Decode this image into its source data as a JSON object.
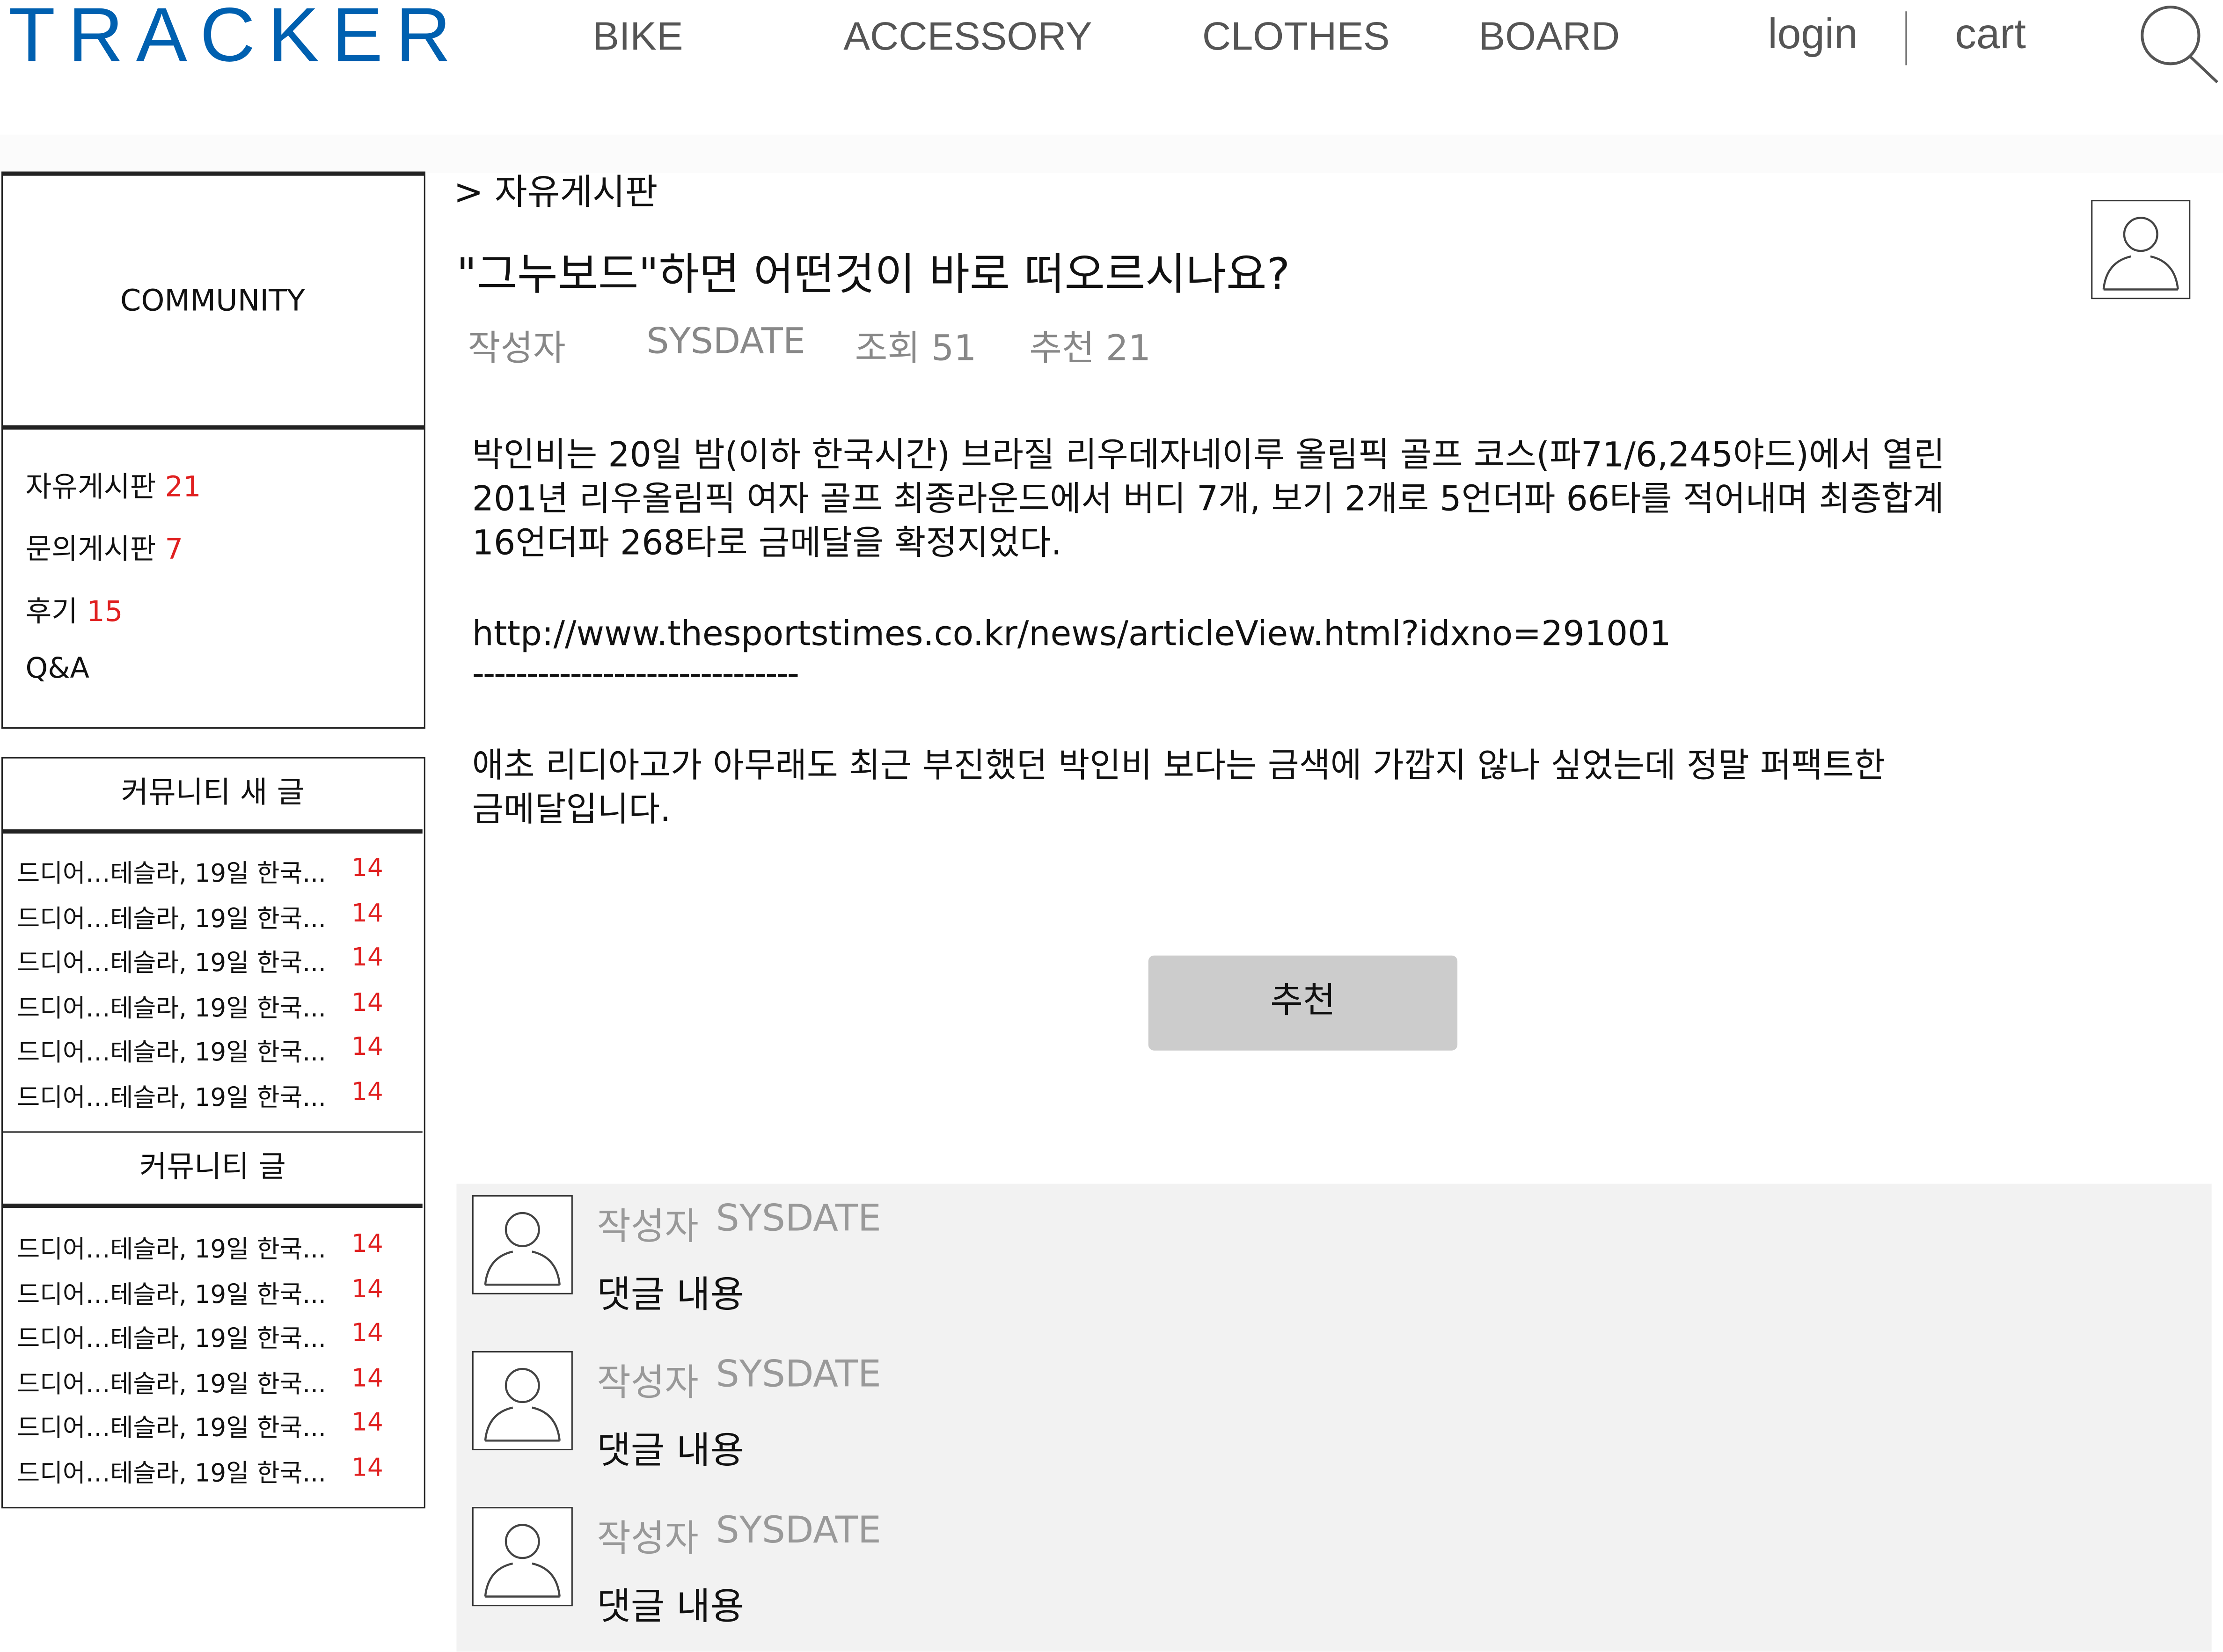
{
  "header": {
    "logo": "TRACKER",
    "nav": [
      "BIKE",
      "ACCESSORY",
      "CLOTHES",
      "BOARD"
    ],
    "login": "login",
    "cart": "cart",
    "search_icon": "search-icon"
  },
  "colors": {
    "brand": "#0060b0",
    "count": "#e02020",
    "comment_bg": "#f2f2f2",
    "button": "#cccccc"
  },
  "sidebar": {
    "title": "COMMUNITY",
    "boards": [
      {
        "label": "자유게시판",
        "count": "21"
      },
      {
        "label": "문의게시판",
        "count": "7"
      },
      {
        "label": "후기",
        "count": "15"
      },
      {
        "label": "Q&A",
        "count": ""
      }
    ],
    "new_posts": {
      "title": "커뮤니티 새 글",
      "items": [
        {
          "title": "드디어…테슬라, 19일 한국...",
          "count": "14"
        },
        {
          "title": "드디어…테슬라, 19일 한국...",
          "count": "14"
        },
        {
          "title": "드디어…테슬라, 19일 한국...",
          "count": "14"
        },
        {
          "title": "드디어…테슬라, 19일 한국...",
          "count": "14"
        },
        {
          "title": "드디어…테슬라, 19일 한국...",
          "count": "14"
        },
        {
          "title": "드디어…테슬라, 19일 한국...",
          "count": "14"
        }
      ]
    },
    "posts": {
      "title": "커뮤니티 글",
      "items": [
        {
          "title": "드디어…테슬라, 19일 한국...",
          "count": "14"
        },
        {
          "title": "드디어…테슬라, 19일 한국...",
          "count": "14"
        },
        {
          "title": "드디어…테슬라, 19일 한국...",
          "count": "14"
        },
        {
          "title": "드디어…테슬라, 19일 한국...",
          "count": "14"
        },
        {
          "title": "드디어…테슬라, 19일 한국...",
          "count": "14"
        },
        {
          "title": "드디어…테슬라, 19일 한국...",
          "count": "14"
        }
      ]
    }
  },
  "post": {
    "breadcrumb": "> 자유게시판",
    "title": "\"그누보드\"하면 어떤것이 바로 떠오르시나요?",
    "author": "작성자",
    "date": "SYSDATE",
    "views": "조회 51",
    "likes": "추천 21",
    "body_lines": [
      "박인비는 20일 밤(이하 한국시간) 브라질 리우데자네이루 올림픽 골프 코스(파71/6,245야드)에서 열린",
      "201년 리우올림픽 여자 골프 최종라운드에서 버디 7개, 보기 2개로 5언더파 66타를 적어내며 최종합계",
      "16언더파 268타로 금메달을 확정지었다."
    ],
    "link": "http://www.thesportstimes.co.kr/news/articleView.html?idxno=291001",
    "separator": "------------------------------",
    "body_lines2": [
      "애초 리디아고가 아무래도 최근 부진했던 박인비 보다는 금색에 가깝지 않나 싶었는데 정말 퍼팩트한",
      "금메달입니다."
    ],
    "recommend_button": "추천"
  },
  "comments": [
    {
      "author": "작성자",
      "date": "SYSDATE",
      "text": "댓글 내용"
    },
    {
      "author": "작성자",
      "date": "SYSDATE",
      "text": "댓글 내용"
    },
    {
      "author": "작성자",
      "date": "SYSDATE",
      "text": "댓글 내용"
    }
  ]
}
